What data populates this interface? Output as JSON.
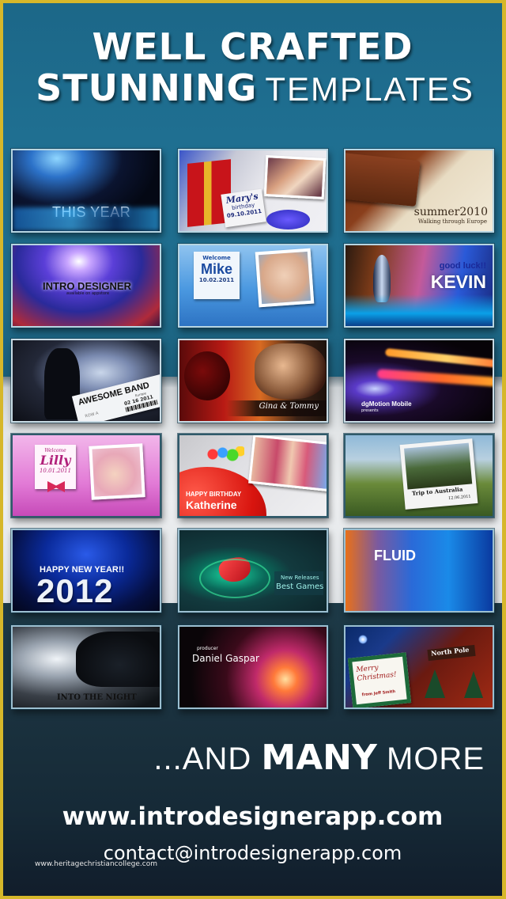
{
  "headline": {
    "line1": "WELL CRAFTED",
    "line2_bold": "STUNNING",
    "line2_regular": "TEMPLATES"
  },
  "templates": [
    {
      "title": "THIS YEAR"
    },
    {
      "title": "Mary's",
      "subtitle": "birthday",
      "date": "09.10.2011"
    },
    {
      "title": "summer2010",
      "subtitle": "Walking through Europe"
    },
    {
      "title": "INTRO DESIGNER",
      "subtitle": "available on appstore"
    },
    {
      "prefix": "Welcome",
      "title": "Mike",
      "date": "10.02.2011"
    },
    {
      "prefix": "good luck!!",
      "title": "KEVIN"
    },
    {
      "title": "AWESOME BAND",
      "subtitle": "Europe",
      "seat": "ROW A",
      "date": "02 16 2011"
    },
    {
      "title": "Gina & Tommy"
    },
    {
      "title": "dgMotion Mobile",
      "subtitle": "presents"
    },
    {
      "prefix": "Welcome",
      "title": "Lilly",
      "date": "10.01.2011"
    },
    {
      "prefix": "HAPPY BIRTHDAY",
      "title": "Katherine"
    },
    {
      "title": "Trip to Australia",
      "date": "12.06.2011"
    },
    {
      "prefix": "HAPPY NEW YEAR!!",
      "title": "2012"
    },
    {
      "prefix": "New Releases",
      "title": "Best Games"
    },
    {
      "title": "FLUID"
    },
    {
      "title": "INTO THE NIGHT"
    },
    {
      "prefix": "producer",
      "title": "Daniel Gaspar"
    },
    {
      "title": "Merry Christmas!",
      "subtitle": "from Jeff Smith",
      "sign": "North Pole"
    }
  ],
  "tagline": {
    "prefix": "...AND",
    "bold": "MANY",
    "suffix": "MORE"
  },
  "contact": {
    "website": "www.introdesignerapp.com",
    "email": "contact@introdesignerapp.com"
  },
  "watermark": "www.heritagechristiancollege.com",
  "colors": {
    "frame": "#d6b72a",
    "top_background": "#1f6f91",
    "middle_band": "#e4e7e9",
    "bottom_background": "#1b3340",
    "thumb_border": "#b6d5e2",
    "text": "#ffffff"
  }
}
